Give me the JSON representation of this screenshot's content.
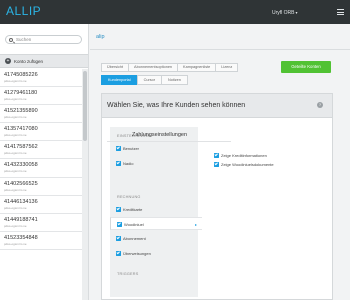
{
  "app": {
    "logo": "ALLIP"
  },
  "topbar": {
    "user_label": "Uryfl ORB"
  },
  "sidebar": {
    "search_placeholder": "Suchen",
    "add_account_label": "Konto zufügen",
    "accounts": [
      {
        "number": "41745085226",
        "sub": "pdus-ogsmrm.ne"
      },
      {
        "number": "41279461180",
        "sub": "pdus-ogsmrm.ne"
      },
      {
        "number": "41521355890",
        "sub": "pdus-ogsmrm.ne"
      },
      {
        "number": "41357417080",
        "sub": "pdus-ogsmrm.ne"
      },
      {
        "number": "41417587562",
        "sub": "pdus-ogsmrm.ne"
      },
      {
        "number": "41432330058",
        "sub": "pdus-ogsmrm.ne"
      },
      {
        "number": "41402566525",
        "sub": "pdus-ogsmrm.ne"
      },
      {
        "number": "41446134136",
        "sub": "pdus-ogsmrm.ne"
      },
      {
        "number": "41449188741",
        "sub": "pdus-ogsmrm.ne"
      },
      {
        "number": "41523354848",
        "sub": "pdus-ogsmrm.ne"
      }
    ]
  },
  "main": {
    "breadcrumb": "alip",
    "tabs_row1": [
      "Übersicht",
      "Abonnementsoptionen",
      "Kampagnenliste",
      "Lizenz"
    ],
    "save_label": "Geteilte Konten",
    "tabs_row2": [
      {
        "label": "Kundenportal",
        "active": true
      },
      {
        "label": "Cursor",
        "active": false
      },
      {
        "label": "Notizen",
        "active": false
      }
    ],
    "panel": {
      "title": "Wählen Sie, was Ihre Kunden sehen können",
      "help": "?",
      "sections": [
        {
          "label": "EINSTELLUNGEN",
          "items": [
            "Benutzer",
            "Nadio"
          ]
        },
        {
          "label": "RECHNUNG",
          "items": [
            "Kreditkarte",
            "Woodiniuel",
            "Abonnement",
            "Überweisungen"
          ]
        },
        {
          "label": "TRIGGERS",
          "items": []
        }
      ],
      "active_item": "Woodiniuel",
      "content_title": "Zahlungseinstellungen",
      "options": [
        "Zeige Kreditinformationen",
        "Zeige Woodiniuelsdokumente"
      ]
    }
  },
  "colors": {
    "topbar": "#2f3436",
    "logo": "#2bb5e6",
    "accent": "#1b9ee1",
    "save_button": "#51c233"
  }
}
